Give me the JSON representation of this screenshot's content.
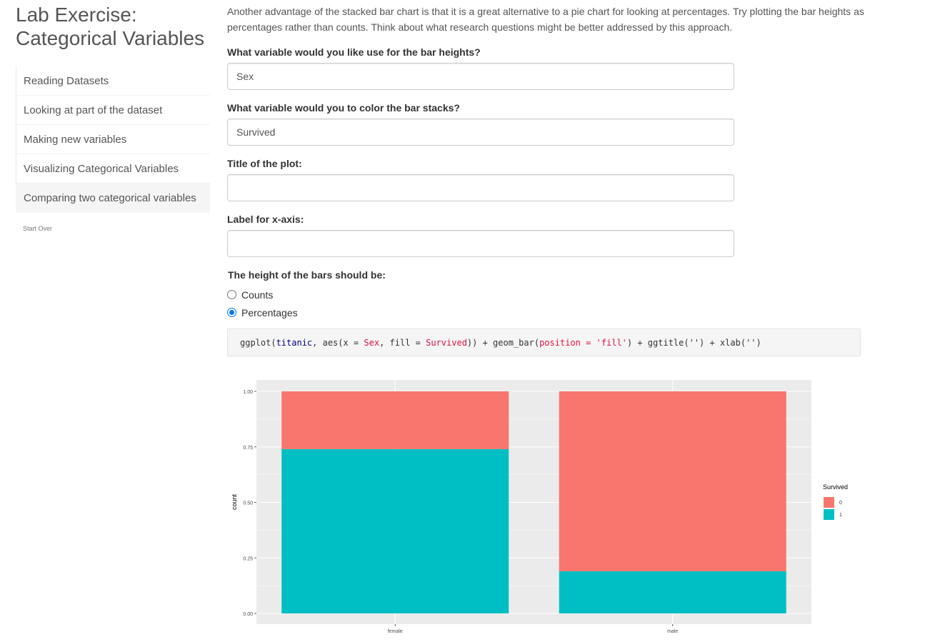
{
  "sidebar": {
    "title": "Lab Exercise: Categorical Variables",
    "items": [
      {
        "label": "Reading Datasets",
        "active": false
      },
      {
        "label": "Looking at part of the dataset",
        "active": false
      },
      {
        "label": "Making new variables",
        "active": false
      },
      {
        "label": "Visualizing Categorical Variables",
        "active": false
      },
      {
        "label": "Comparing two categorical variables",
        "active": true
      }
    ],
    "start_over": "Start Over"
  },
  "main": {
    "intro": "Another advantage of the stacked bar chart is that it is a great alternative to a pie chart for looking at percentages. Try plotting the bar heights as percentages rather than counts. Think about what research questions might be better addressed by this approach.",
    "fields": {
      "bar_heights": {
        "label": "What variable would you like use for the bar heights?",
        "value": "Sex",
        "placeholder": ""
      },
      "color_stacks": {
        "label": "What variable would you to color the bar stacks?",
        "value": "Survived",
        "placeholder": ""
      },
      "plot_title": {
        "label": "Title of the plot:",
        "value": "",
        "placeholder": ""
      },
      "x_label": {
        "label": "Label for x-axis:",
        "value": "",
        "placeholder": ""
      }
    },
    "radio": {
      "label": "The height of the bars should be:",
      "options": [
        {
          "label": "Counts",
          "checked": false
        },
        {
          "label": "Percentages",
          "checked": true
        }
      ]
    },
    "code": {
      "tokens": [
        {
          "t": "ggplot(",
          "c": ""
        },
        {
          "t": "titanic",
          "c": "fn"
        },
        {
          "t": ", aes(x = ",
          "c": ""
        },
        {
          "t": "Sex",
          "c": "str"
        },
        {
          "t": ", fill = ",
          "c": ""
        },
        {
          "t": "Survived",
          "c": "str"
        },
        {
          "t": ")) + geom_bar(",
          "c": ""
        },
        {
          "t": "position = 'fill'",
          "c": "str"
        },
        {
          "t": ") + ggtitle('') + xlab('')",
          "c": ""
        }
      ]
    }
  },
  "colors": {
    "fill_0": "#F8766D",
    "fill_1": "#00BFC4",
    "panel_bg": "#EBEBEB"
  },
  "chart_data": {
    "type": "bar",
    "stacked": true,
    "categories": [
      "female",
      "male"
    ],
    "series": [
      {
        "name": "0",
        "values": [
          0.26,
          0.81
        ],
        "color": "#F8766D"
      },
      {
        "name": "1",
        "values": [
          0.74,
          0.19
        ],
        "color": "#00BFC4"
      }
    ],
    "ylabel": "count",
    "xlabel": "",
    "ylim": [
      0,
      1
    ],
    "yticks": [
      "0.00",
      "0.25",
      "0.50",
      "0.75",
      "1.00"
    ],
    "legend_title": "Survived",
    "legend_position": "right",
    "grid": true
  }
}
